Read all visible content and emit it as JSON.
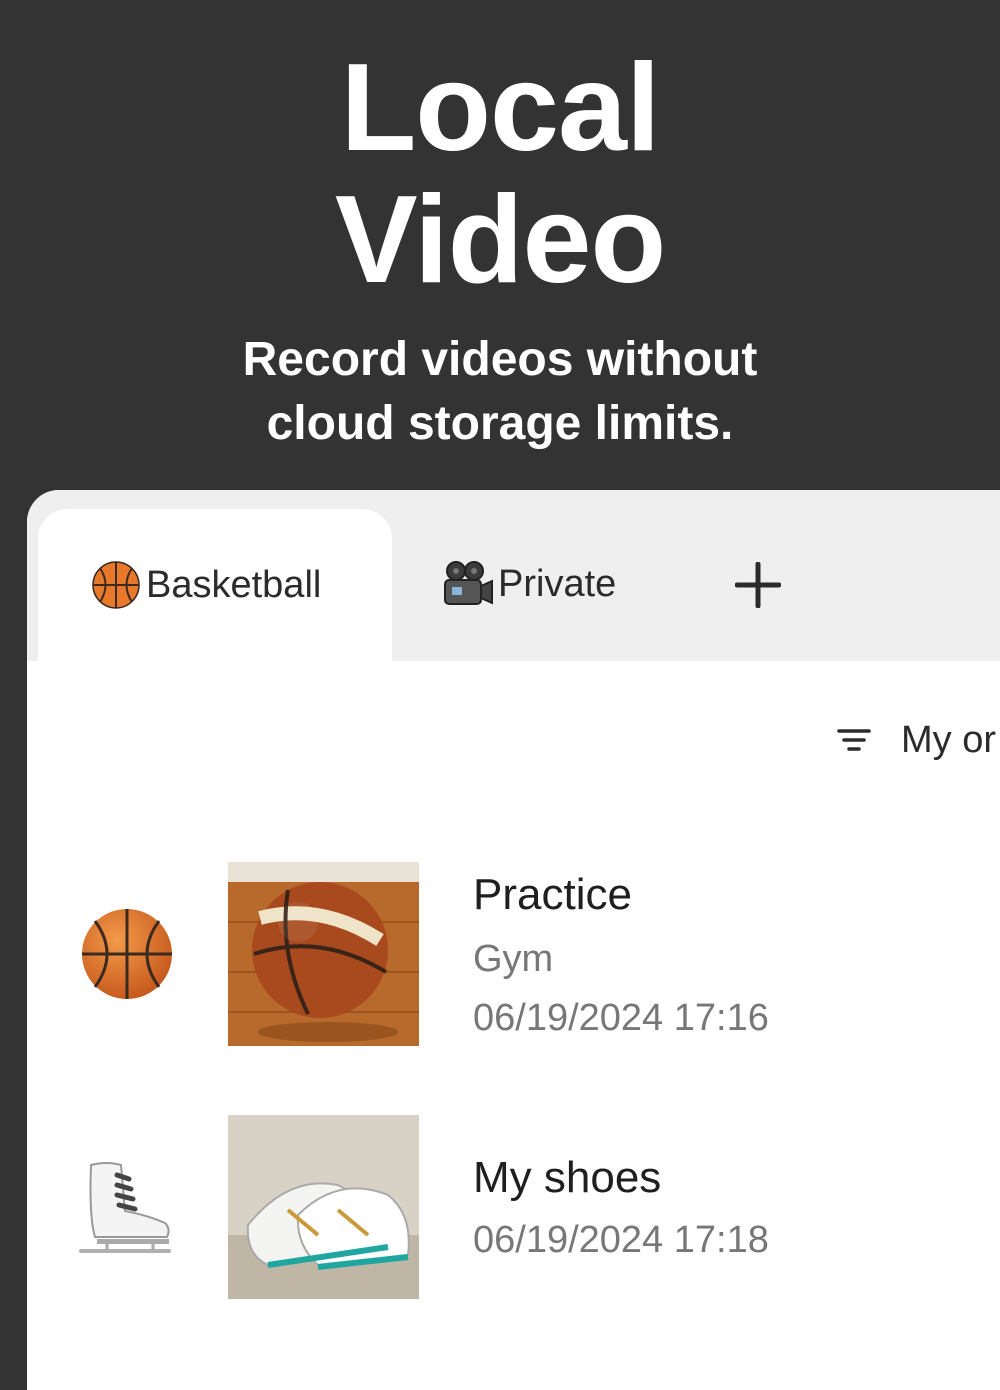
{
  "hero": {
    "title_line1": "Local",
    "title_line2": "Video",
    "subtitle_line1": "Record videos without",
    "subtitle_line2": "cloud storage limits."
  },
  "tabs": [
    {
      "emoji": "🏀",
      "icon": "basketball-icon",
      "label": "Basketball",
      "active": true
    },
    {
      "emoji": "🎥",
      "icon": "movie-camera-icon",
      "label": "Private",
      "active": false
    }
  ],
  "add_tab": {
    "icon": "plus-icon"
  },
  "sort": {
    "icon": "filter-icon",
    "label": "My or"
  },
  "videos": [
    {
      "icon": "basketball-icon",
      "thumbnail": "basketball-thumbnail",
      "title": "Practice",
      "location": "Gym",
      "datetime": "06/19/2024 17:16"
    },
    {
      "icon": "ice-skate-icon",
      "thumbnail": "shoes-thumbnail",
      "title": "My shoes",
      "datetime": "06/19/2024 17:18"
    }
  ],
  "colors": {
    "background": "#333333",
    "tabbar": "#efefef",
    "text_primary": "#1f1f1f",
    "text_secondary": "#777777"
  }
}
